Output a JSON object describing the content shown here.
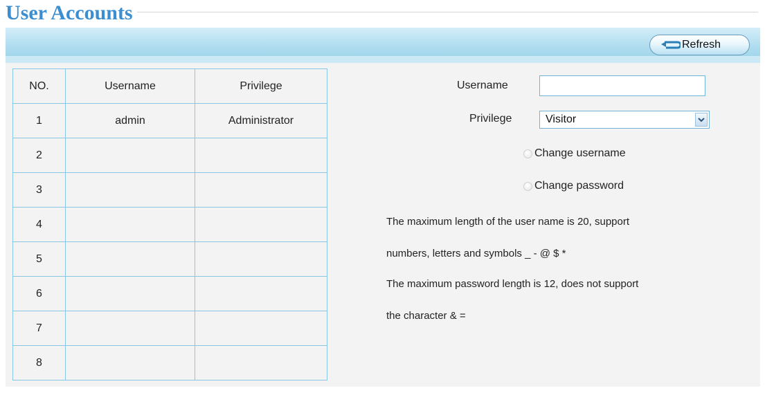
{
  "page": {
    "title": "User Accounts"
  },
  "toolbar": {
    "refresh_label": "Refresh"
  },
  "table": {
    "headers": [
      "NO.",
      "Username",
      "Privilege"
    ],
    "rows": [
      [
        "1",
        "admin",
        "Administrator"
      ],
      [
        "2",
        "",
        ""
      ],
      [
        "3",
        "",
        ""
      ],
      [
        "4",
        "",
        ""
      ],
      [
        "5",
        "",
        ""
      ],
      [
        "6",
        "",
        ""
      ],
      [
        "7",
        "",
        ""
      ],
      [
        "8",
        "",
        ""
      ]
    ]
  },
  "form": {
    "username_label": "Username",
    "username_value": "",
    "privilege_label": "Privilege",
    "privilege_value": "Visitor",
    "change_username_label": "Change username",
    "change_password_label": "Change password"
  },
  "notes": {
    "line1": "The maximum length of the user name is 20, support",
    "line2": "numbers, letters and symbols _ - @ $ *",
    "line3": "The maximum password length is 12, does not support",
    "line4": "the character & ="
  },
  "colors": {
    "title": "#3b8ed0",
    "header_bar": "#aedcef",
    "table_border": "#88c6e4",
    "panel_bg": "#f3f3f3"
  }
}
